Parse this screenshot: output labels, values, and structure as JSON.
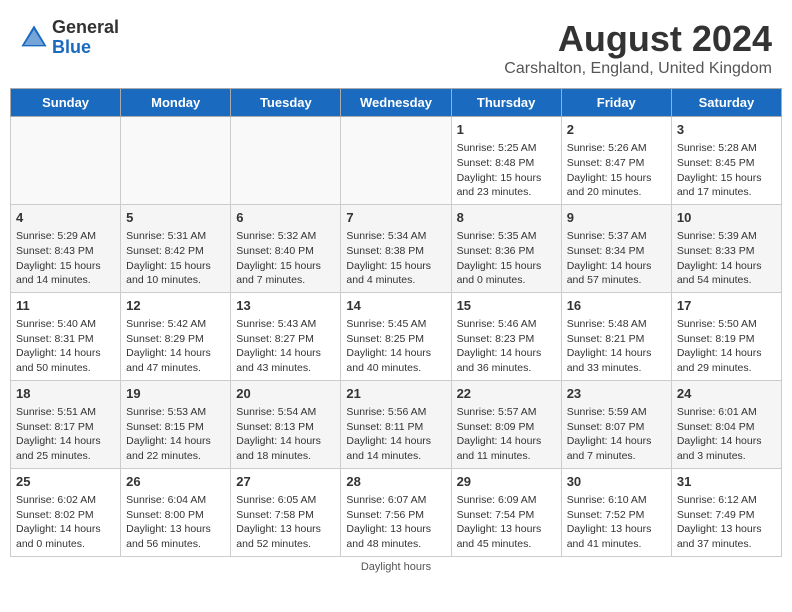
{
  "header": {
    "logo_general": "General",
    "logo_blue": "Blue",
    "month_title": "August 2024",
    "location": "Carshalton, England, United Kingdom"
  },
  "days_of_week": [
    "Sunday",
    "Monday",
    "Tuesday",
    "Wednesday",
    "Thursday",
    "Friday",
    "Saturday"
  ],
  "weeks": [
    [
      {
        "day": "",
        "info": ""
      },
      {
        "day": "",
        "info": ""
      },
      {
        "day": "",
        "info": ""
      },
      {
        "day": "",
        "info": ""
      },
      {
        "day": "1",
        "info": "Sunrise: 5:25 AM\nSunset: 8:48 PM\nDaylight: 15 hours\nand 23 minutes."
      },
      {
        "day": "2",
        "info": "Sunrise: 5:26 AM\nSunset: 8:47 PM\nDaylight: 15 hours\nand 20 minutes."
      },
      {
        "day": "3",
        "info": "Sunrise: 5:28 AM\nSunset: 8:45 PM\nDaylight: 15 hours\nand 17 minutes."
      }
    ],
    [
      {
        "day": "4",
        "info": "Sunrise: 5:29 AM\nSunset: 8:43 PM\nDaylight: 15 hours\nand 14 minutes."
      },
      {
        "day": "5",
        "info": "Sunrise: 5:31 AM\nSunset: 8:42 PM\nDaylight: 15 hours\nand 10 minutes."
      },
      {
        "day": "6",
        "info": "Sunrise: 5:32 AM\nSunset: 8:40 PM\nDaylight: 15 hours\nand 7 minutes."
      },
      {
        "day": "7",
        "info": "Sunrise: 5:34 AM\nSunset: 8:38 PM\nDaylight: 15 hours\nand 4 minutes."
      },
      {
        "day": "8",
        "info": "Sunrise: 5:35 AM\nSunset: 8:36 PM\nDaylight: 15 hours\nand 0 minutes."
      },
      {
        "day": "9",
        "info": "Sunrise: 5:37 AM\nSunset: 8:34 PM\nDaylight: 14 hours\nand 57 minutes."
      },
      {
        "day": "10",
        "info": "Sunrise: 5:39 AM\nSunset: 8:33 PM\nDaylight: 14 hours\nand 54 minutes."
      }
    ],
    [
      {
        "day": "11",
        "info": "Sunrise: 5:40 AM\nSunset: 8:31 PM\nDaylight: 14 hours\nand 50 minutes."
      },
      {
        "day": "12",
        "info": "Sunrise: 5:42 AM\nSunset: 8:29 PM\nDaylight: 14 hours\nand 47 minutes."
      },
      {
        "day": "13",
        "info": "Sunrise: 5:43 AM\nSunset: 8:27 PM\nDaylight: 14 hours\nand 43 minutes."
      },
      {
        "day": "14",
        "info": "Sunrise: 5:45 AM\nSunset: 8:25 PM\nDaylight: 14 hours\nand 40 minutes."
      },
      {
        "day": "15",
        "info": "Sunrise: 5:46 AM\nSunset: 8:23 PM\nDaylight: 14 hours\nand 36 minutes."
      },
      {
        "day": "16",
        "info": "Sunrise: 5:48 AM\nSunset: 8:21 PM\nDaylight: 14 hours\nand 33 minutes."
      },
      {
        "day": "17",
        "info": "Sunrise: 5:50 AM\nSunset: 8:19 PM\nDaylight: 14 hours\nand 29 minutes."
      }
    ],
    [
      {
        "day": "18",
        "info": "Sunrise: 5:51 AM\nSunset: 8:17 PM\nDaylight: 14 hours\nand 25 minutes."
      },
      {
        "day": "19",
        "info": "Sunrise: 5:53 AM\nSunset: 8:15 PM\nDaylight: 14 hours\nand 22 minutes."
      },
      {
        "day": "20",
        "info": "Sunrise: 5:54 AM\nSunset: 8:13 PM\nDaylight: 14 hours\nand 18 minutes."
      },
      {
        "day": "21",
        "info": "Sunrise: 5:56 AM\nSunset: 8:11 PM\nDaylight: 14 hours\nand 14 minutes."
      },
      {
        "day": "22",
        "info": "Sunrise: 5:57 AM\nSunset: 8:09 PM\nDaylight: 14 hours\nand 11 minutes."
      },
      {
        "day": "23",
        "info": "Sunrise: 5:59 AM\nSunset: 8:07 PM\nDaylight: 14 hours\nand 7 minutes."
      },
      {
        "day": "24",
        "info": "Sunrise: 6:01 AM\nSunset: 8:04 PM\nDaylight: 14 hours\nand 3 minutes."
      }
    ],
    [
      {
        "day": "25",
        "info": "Sunrise: 6:02 AM\nSunset: 8:02 PM\nDaylight: 14 hours\nand 0 minutes."
      },
      {
        "day": "26",
        "info": "Sunrise: 6:04 AM\nSunset: 8:00 PM\nDaylight: 13 hours\nand 56 minutes."
      },
      {
        "day": "27",
        "info": "Sunrise: 6:05 AM\nSunset: 7:58 PM\nDaylight: 13 hours\nand 52 minutes."
      },
      {
        "day": "28",
        "info": "Sunrise: 6:07 AM\nSunset: 7:56 PM\nDaylight: 13 hours\nand 48 minutes."
      },
      {
        "day": "29",
        "info": "Sunrise: 6:09 AM\nSunset: 7:54 PM\nDaylight: 13 hours\nand 45 minutes."
      },
      {
        "day": "30",
        "info": "Sunrise: 6:10 AM\nSunset: 7:52 PM\nDaylight: 13 hours\nand 41 minutes."
      },
      {
        "day": "31",
        "info": "Sunrise: 6:12 AM\nSunset: 7:49 PM\nDaylight: 13 hours\nand 37 minutes."
      }
    ]
  ],
  "footer": "Daylight hours"
}
